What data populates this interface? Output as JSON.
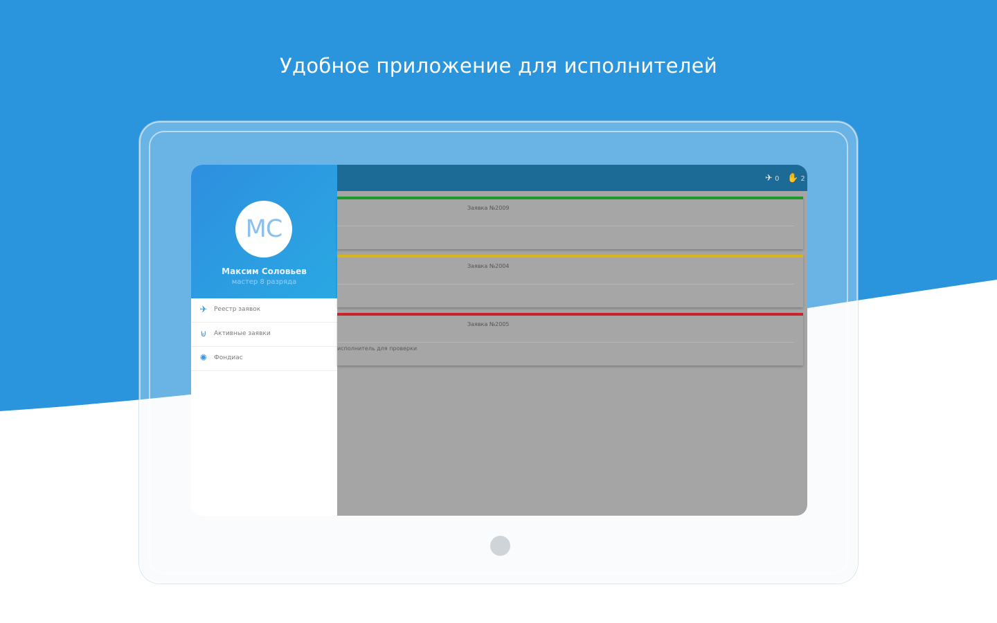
{
  "headline": "Удобное приложение для исполнителей",
  "colors": {
    "background_blue": "#2a95dd",
    "wave_white": "#ffffff",
    "toolbar": "#1c6a96",
    "content_dim": "#a5a5a5",
    "status_green": "#1e9a2a",
    "status_yellow": "#d9b51a",
    "status_red": "#c8242a"
  },
  "profile": {
    "initials": "МС",
    "name": "Максим Соловьев",
    "role": "мастер 8 разряда"
  },
  "menu": [
    {
      "icon": "registry-icon",
      "glyph": "✈",
      "label": "Реестр заявок"
    },
    {
      "icon": "active-requests-icon",
      "glyph": "⊌",
      "label": "Активные заявки"
    },
    {
      "icon": "settings-icon",
      "glyph": "✺",
      "label": "Фондиас"
    }
  ],
  "toolbar": {
    "stat_1_icon": "plane-icon",
    "stat_1_glyph": "✈",
    "stat_1_value": "0",
    "stat_2_icon": "hand-icon",
    "stat_2_glyph": "✋",
    "stat_2_value": "2"
  },
  "cards": [
    {
      "status": "green",
      "title": "Заявка №2009",
      "note": ""
    },
    {
      "status": "yellow",
      "title": "Заявка №2004",
      "note": ""
    },
    {
      "status": "red",
      "title": "Заявка №2005",
      "note": "исполнитель для проверки"
    }
  ]
}
